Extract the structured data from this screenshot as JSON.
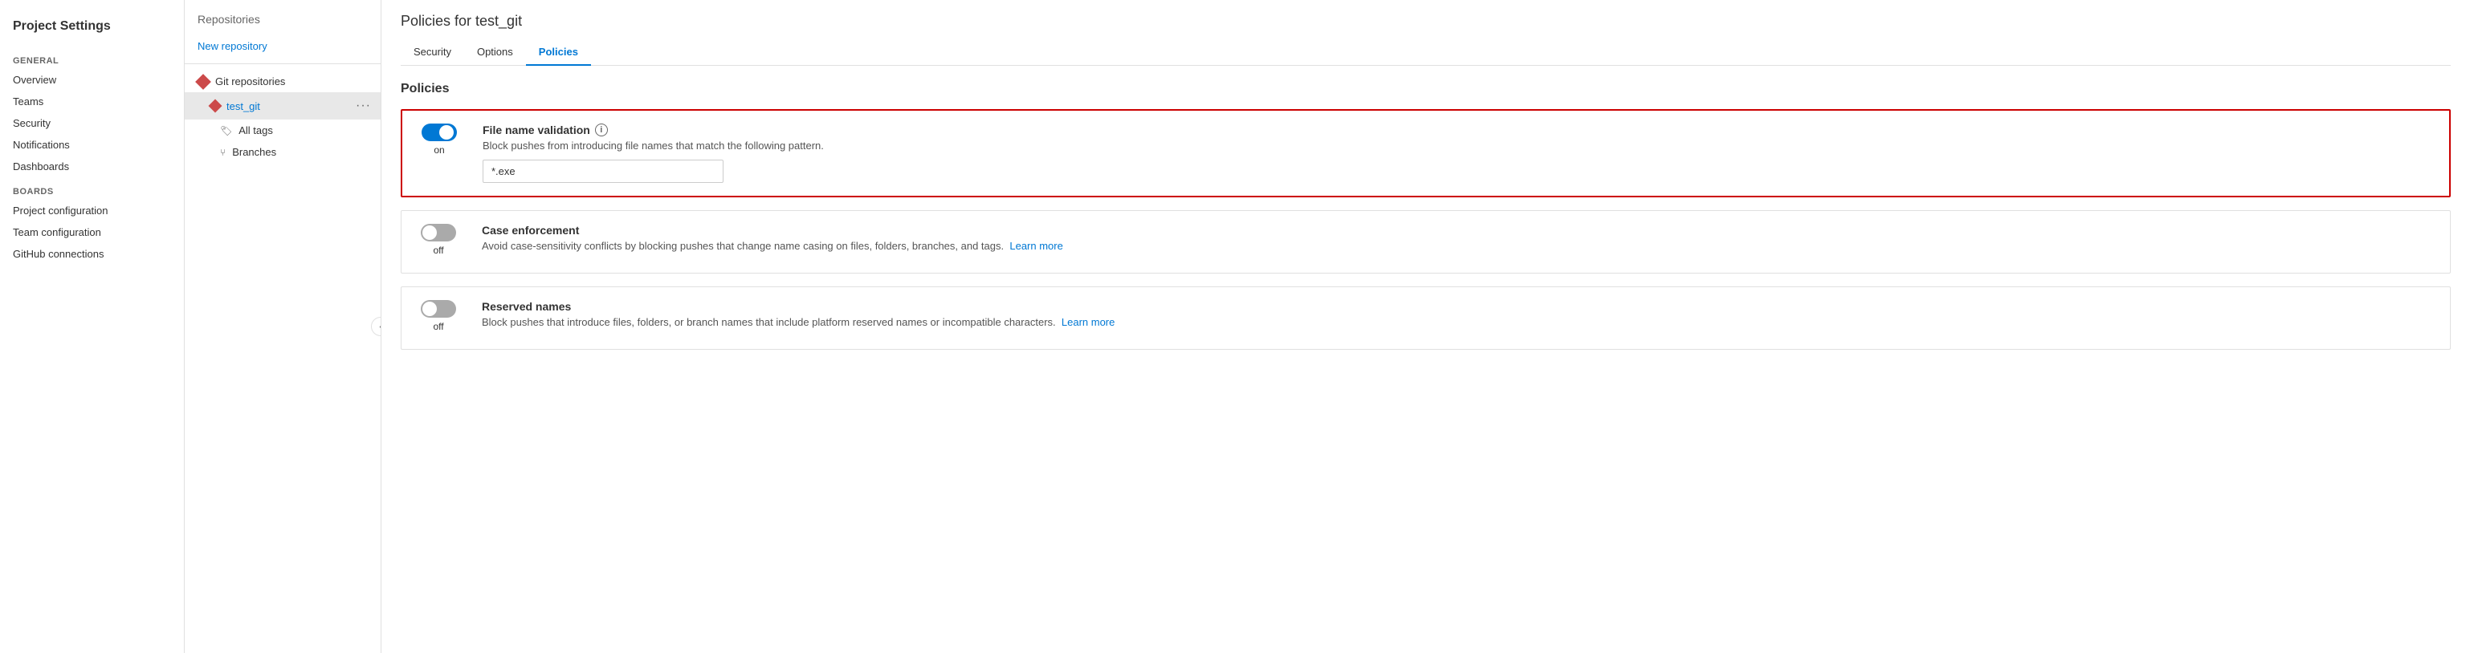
{
  "sidebar_left": {
    "title": "Project Settings",
    "general_section": "General",
    "nav_items": [
      {
        "label": "Overview",
        "id": "overview"
      },
      {
        "label": "Teams",
        "id": "teams"
      },
      {
        "label": "Security",
        "id": "security"
      },
      {
        "label": "Notifications",
        "id": "notifications"
      },
      {
        "label": "Dashboards",
        "id": "dashboards"
      }
    ],
    "boards_section": "Boards",
    "boards_items": [
      {
        "label": "Project configuration",
        "id": "project-configuration"
      },
      {
        "label": "Team configuration",
        "id": "team-configuration"
      },
      {
        "label": "GitHub connections",
        "id": "github-connections"
      }
    ]
  },
  "sidebar_middle": {
    "title": "Repositories",
    "new_repository_label": "New repository",
    "git_repositories_label": "Git repositories",
    "repo_name": "test_git",
    "all_tags_label": "All tags",
    "branches_label": "Branches"
  },
  "main": {
    "page_title": "Policies for test_git",
    "tabs": [
      {
        "label": "Security",
        "id": "security",
        "active": false
      },
      {
        "label": "Options",
        "id": "options",
        "active": false
      },
      {
        "label": "Policies",
        "id": "policies",
        "active": true
      }
    ],
    "policies_section_title": "Policies",
    "policies": [
      {
        "id": "file-name-validation",
        "title": "File name validation",
        "toggle_state": "on",
        "toggle_on": true,
        "description": "Block pushes from introducing file names that match the following pattern.",
        "input_value": "*.exe",
        "highlighted": true,
        "has_info_icon": true,
        "has_input": true
      },
      {
        "id": "case-enforcement",
        "title": "Case enforcement",
        "toggle_state": "off",
        "toggle_on": false,
        "description": "Avoid case-sensitivity conflicts by blocking pushes that change name casing on files, folders, branches, and tags.",
        "learn_more_label": "Learn more",
        "highlighted": false,
        "has_input": false
      },
      {
        "id": "reserved-names",
        "title": "Reserved names",
        "toggle_state": "off",
        "toggle_on": false,
        "description": "Block pushes that introduce files, folders, or branch names that include platform reserved names or incompatible characters.",
        "learn_more_label": "Learn more",
        "highlighted": false,
        "has_input": false
      }
    ]
  }
}
